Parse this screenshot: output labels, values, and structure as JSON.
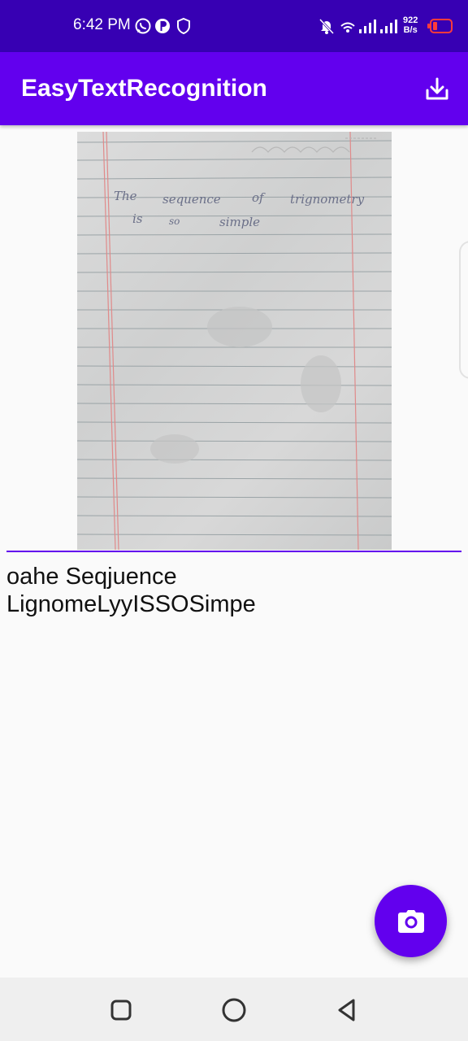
{
  "status_bar": {
    "time": "6:42 PM",
    "net_speed_value": "922",
    "net_speed_unit": "B/s",
    "icons": [
      "whatsapp-icon",
      "p-app-icon",
      "shield-icon",
      "bell-off-icon",
      "wifi-icon",
      "signal-icon",
      "signal-icon",
      "battery-low-icon"
    ]
  },
  "app_bar": {
    "title": "EasyTextRecognition",
    "download_icon": "download-icon"
  },
  "photo": {
    "line1": [
      "The",
      "sequence",
      "of",
      "trignometry"
    ],
    "line2": [
      "is",
      "so",
      "simple"
    ]
  },
  "result": {
    "text": "oahe Seqjuence\nLignomeLyyISSOSimpe"
  },
  "fab": {
    "icon": "camera-icon"
  },
  "nav_bar": {
    "icons": [
      "recent-apps-icon",
      "home-icon",
      "back-icon"
    ]
  },
  "colors": {
    "primary": "#6200ee",
    "primary_dark": "#3700b3"
  }
}
